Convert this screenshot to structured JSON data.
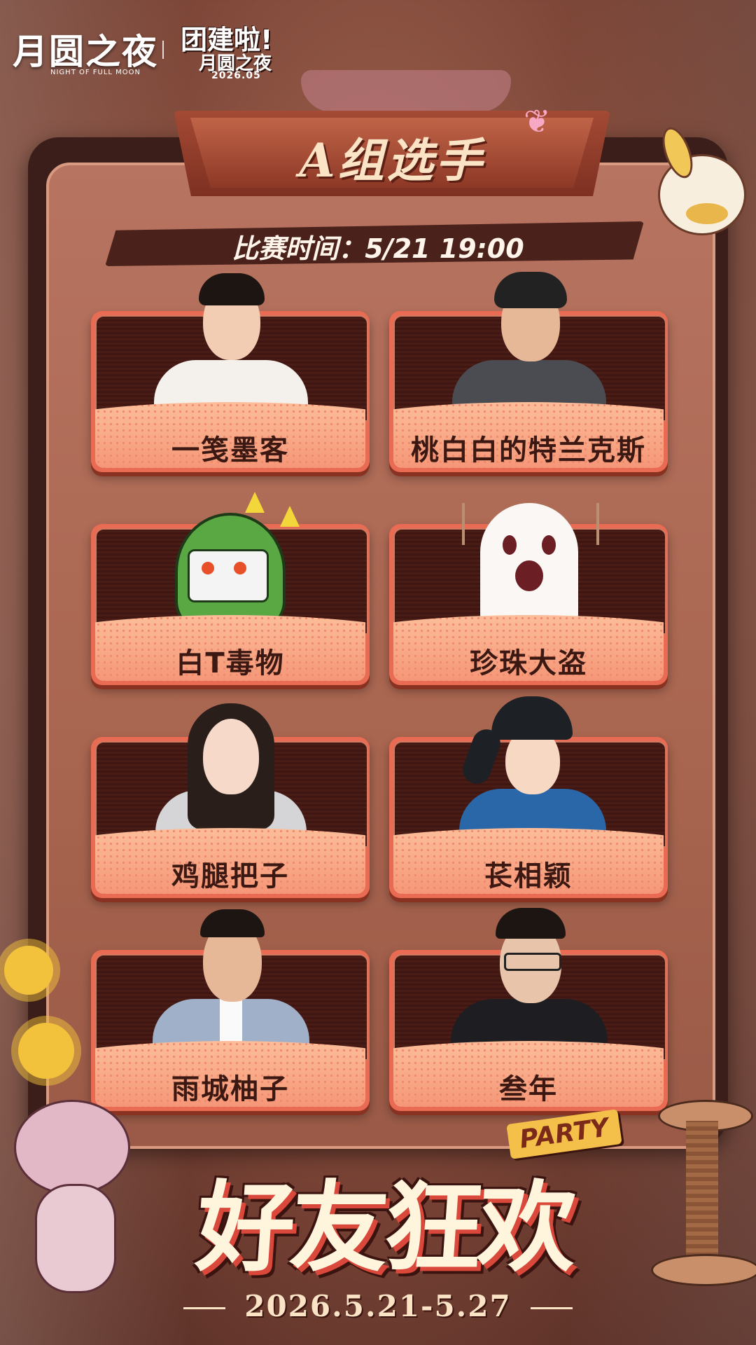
{
  "logo": {
    "brand_cn": "月圆之夜",
    "brand_en": "NIGHT OF FULL MOON",
    "event_line1": "团建啦!",
    "event_line2": "月圆之夜",
    "event_date": "2026.05"
  },
  "header": {
    "group_title": "A组选手",
    "match_time": "比赛时间：5/21 19:00"
  },
  "players": [
    {
      "name": "一笺墨客",
      "avatar": "photo"
    },
    {
      "name": "桃白白的特兰克斯",
      "avatar": "photo"
    },
    {
      "name": "白T毒物",
      "avatar": "green-dinosaur-icon"
    },
    {
      "name": "珍珠大盗",
      "avatar": "ghost-icon"
    },
    {
      "name": "鸡腿把子",
      "avatar": "photo"
    },
    {
      "name": "苌相颖",
      "avatar": "illustrated-character"
    },
    {
      "name": "雨城柚子",
      "avatar": "photo"
    },
    {
      "name": "叁年",
      "avatar": "photo"
    }
  ],
  "footer": {
    "party_tag": "PARTY",
    "slogan": "好友狂欢",
    "date_range": "2026.5.21-5.27"
  },
  "colors": {
    "panel": "#3b1e19",
    "card_accent": "#e96b53",
    "title_text": "#fbe3c6"
  }
}
